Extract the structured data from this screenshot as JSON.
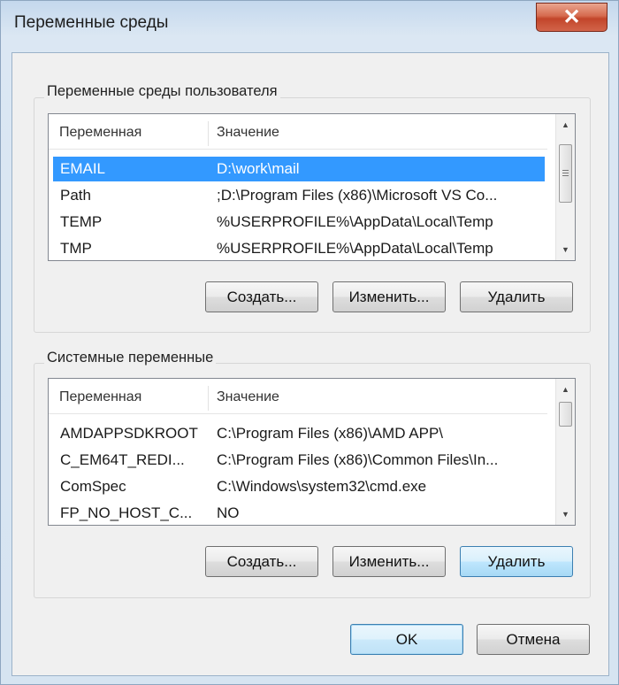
{
  "window": {
    "title": "Переменные среды",
    "close_glyph": "✕"
  },
  "user_vars": {
    "group_label": "Переменные среды пользователя",
    "columns": [
      "Переменная",
      "Значение"
    ],
    "rows": [
      {
        "name": "EMAIL",
        "value": "D:\\work\\mail",
        "selected": true
      },
      {
        "name": "Path",
        "value": ";D:\\Program Files (x86)\\Microsoft VS Co...",
        "selected": false
      },
      {
        "name": "TEMP",
        "value": "%USERPROFILE%\\AppData\\Local\\Temp",
        "selected": false
      },
      {
        "name": "TMP",
        "value": "%USERPROFILE%\\AppData\\Local\\Temp",
        "selected": false
      }
    ],
    "buttons": {
      "create": "Создать...",
      "edit": "Изменить...",
      "delete": "Удалить"
    }
  },
  "system_vars": {
    "group_label": "Системные переменные",
    "columns": [
      "Переменная",
      "Значение"
    ],
    "rows": [
      {
        "name": "AMDAPPSDKROOT",
        "value": "C:\\Program Files (x86)\\AMD APP\\"
      },
      {
        "name": "C_EM64T_REDI...",
        "value": "C:\\Program Files (x86)\\Common Files\\In..."
      },
      {
        "name": "ComSpec",
        "value": "C:\\Windows\\system32\\cmd.exe"
      },
      {
        "name": "FP_NO_HOST_C...",
        "value": "NO"
      }
    ],
    "buttons": {
      "create": "Создать...",
      "edit": "Изменить...",
      "delete": "Удалить"
    }
  },
  "dialog_buttons": {
    "ok": "OK",
    "cancel": "Отмена"
  },
  "scroll_icons": {
    "up": "▲",
    "down": "▼"
  },
  "colors": {
    "selection": "#3399ff",
    "close_button": "#c2452a",
    "hover_blue": "#3c7fb1"
  }
}
